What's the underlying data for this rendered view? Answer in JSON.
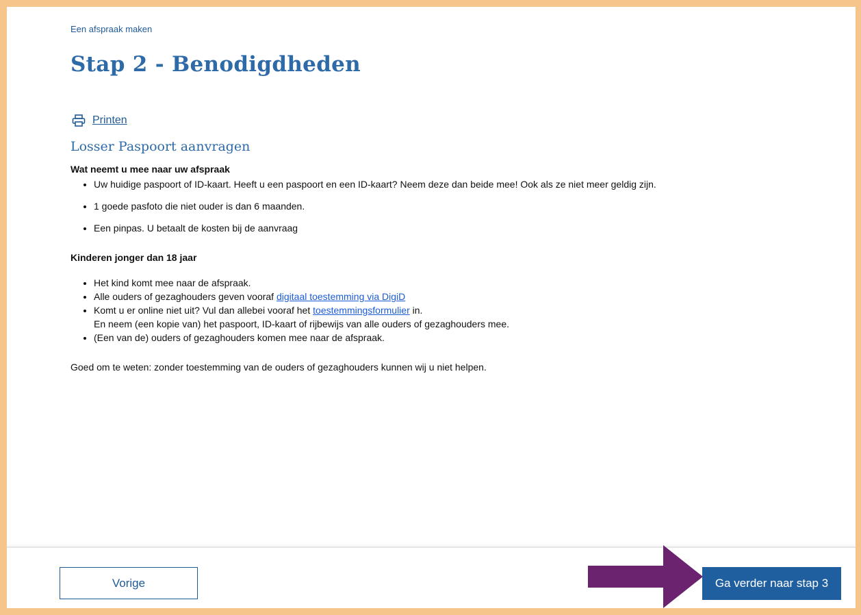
{
  "breadcrumb": "Een afspraak maken",
  "title": "Stap 2 - Benodigdheden",
  "print_label": "Printen",
  "section_title": "Losser Paspoort aanvragen",
  "bring": {
    "heading": "Wat neemt u mee naar uw afspraak",
    "items": [
      "Uw huidige paspoort of ID-kaart. Heeft u een paspoort en een ID-kaart? Neem deze dan beide mee! Ook als ze niet meer geldig zijn.",
      "1 goede pasfoto die niet ouder is dan 6 maanden.",
      "Een pinpas. U betaalt de kosten bij de aanvraag"
    ]
  },
  "children": {
    "heading": "Kinderen jonger dan 18 jaar",
    "item1": "Het kind komt mee naar de afspraak.",
    "item2_text": "Alle ouders of gezaghouders geven vooraf ",
    "item2_link": "digitaal toestemming via DigiD",
    "item3_text": "Komt u er online niet uit? Vul dan allebei vooraf het ",
    "item3_link": "toestemmingsformulier",
    "item3_after": " in.",
    "item3_line2": "En neem (een kopie van) het paspoort, ID-kaart of rijbewijs van alle ouders of gezaghouders mee.",
    "item4": "(Een van de) ouders of gezaghouders komen mee naar de afspraak.",
    "note": "Goed om te weten: zonder toestemming van de ouders of gezaghouders kunnen wij u niet helpen."
  },
  "footer": {
    "prev_label": "Vorige",
    "next_label": "Ga verder naar stap 3"
  },
  "colors": {
    "frame": "#f5c58c",
    "primary": "#1f5fa0",
    "heading": "#2d6aa7",
    "link": "#1a5bd6",
    "arrow": "#6b2370"
  },
  "icons": {
    "print": "printer-icon",
    "annotation": "arrow-right-icon"
  }
}
